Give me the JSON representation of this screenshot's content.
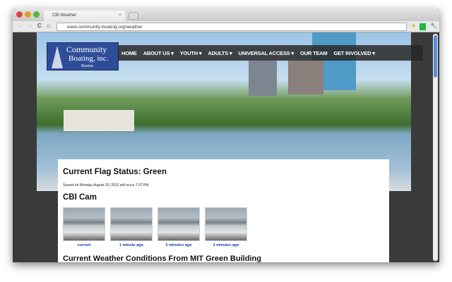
{
  "browser": {
    "tab_title": "CBI Weather",
    "url": "www.community-boating.org/weather"
  },
  "logo": {
    "line1": "Community",
    "line2": "Boating, inc.",
    "line3": "Boston"
  },
  "nav": {
    "items": [
      "HOME",
      "ABOUT US ▾",
      "YOUTH ▾",
      "ADULTS ▾",
      "UNIVERSAL ACCESS ▾",
      "OUR TEAM",
      "GET INVOLVED ▾"
    ]
  },
  "main": {
    "flag_title": "Current Flag Status: Green",
    "sunset": "Sunset for Monday August 20, 2012 will occur 7:37 PM",
    "cam_title": "CBI Cam",
    "cams": [
      "current",
      "1 minute ago",
      "2 minutes ago",
      "3 minutes ago"
    ],
    "weather_title": "Current Weather Conditions From MIT Green Building"
  },
  "colors": {
    "logo_bg": "#2e4d98",
    "link": "#1a3aa8",
    "flag_status": "Green"
  }
}
